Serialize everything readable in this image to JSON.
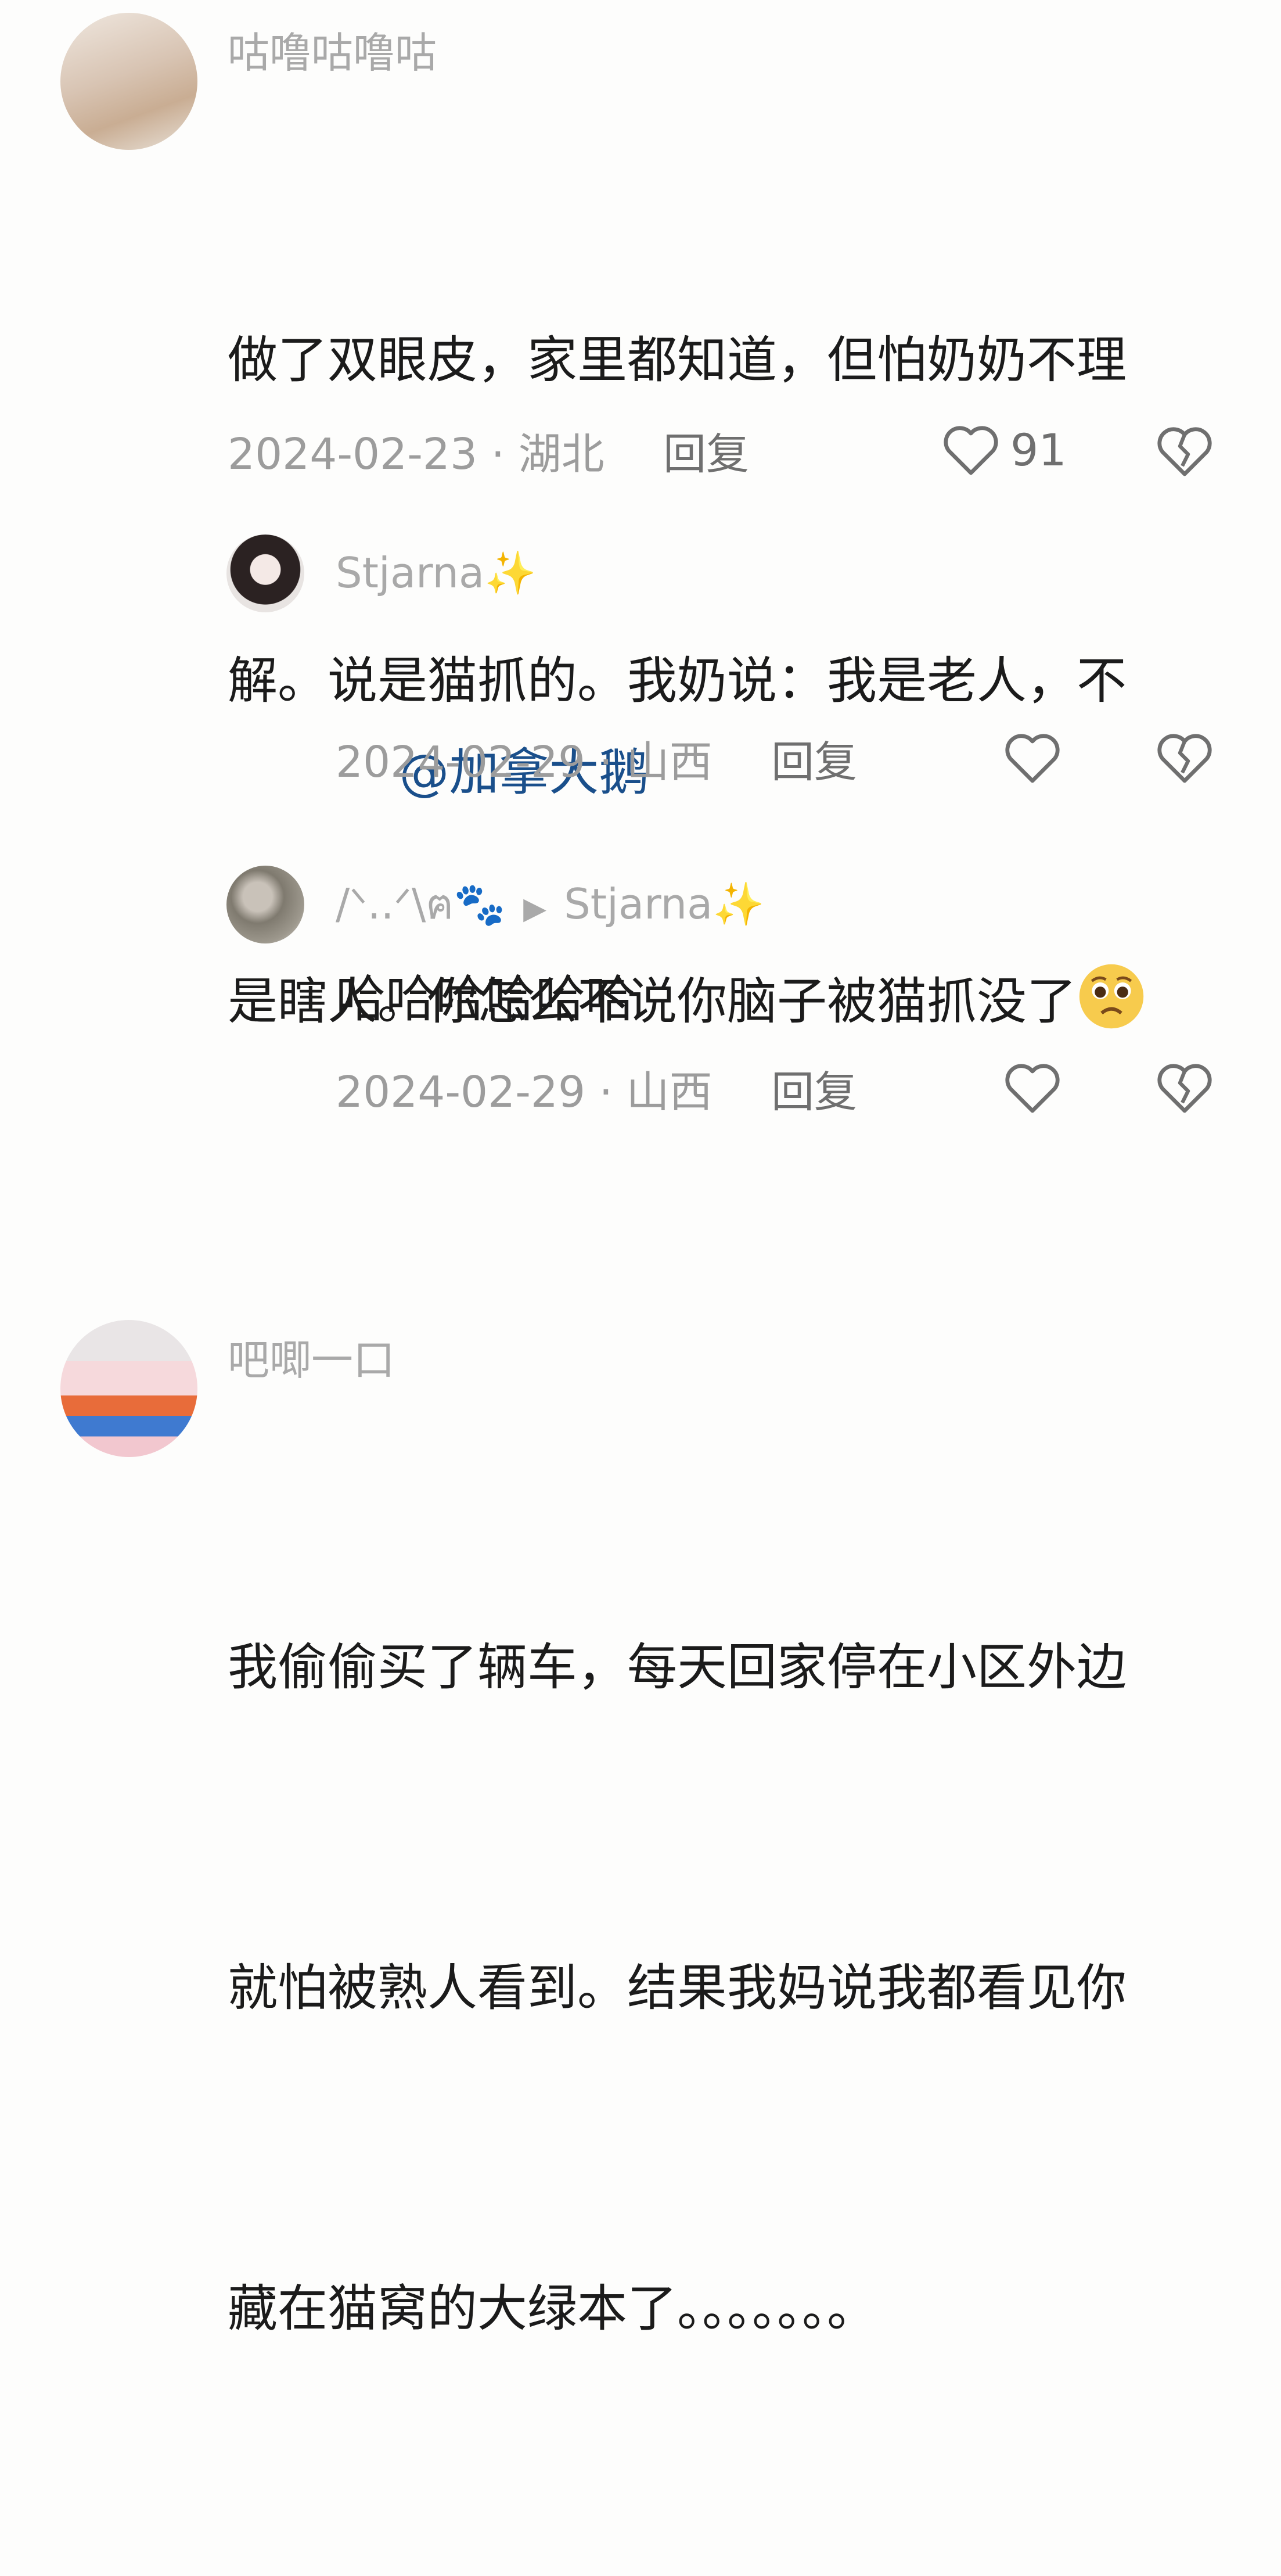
{
  "comments": [
    {
      "user": "咕噜咕噜咕",
      "lines": [
        "做了双眼皮，家里都知道，但怕奶奶不理",
        "解。说是猫抓的。我奶说：我是老人，不",
        "是瞎人。你怎么不说你脑子被猫抓没了"
      ],
      "emoji": "pleading-face-emoji",
      "meta": "2024-02-23 · 湖北",
      "reply_label": "回复",
      "likes": "91",
      "replies": [
        {
          "user": "Stjarna",
          "user_suffix": "✨",
          "text": "@加拿大鹅",
          "meta": "2024-02-29 · 山西",
          "reply_label": "回复"
        },
        {
          "user": "/ᐠ..ᐟ\\ฅ🐾",
          "reply_arrow": "▶",
          "reply_to": "Stjarna",
          "reply_to_suffix": "✨",
          "text": "哈哈哈哈哈哈",
          "meta": "2024-02-29 · 山西",
          "reply_label": "回复"
        }
      ]
    },
    {
      "user": "吧唧一口",
      "lines": [
        "我偷偷买了辆车，每天回家停在小区外边",
        "就怕被熟人看到。结果我妈说我都看见你",
        "藏在猫窝的大绿本了。。。。。。。"
      ]
    }
  ]
}
